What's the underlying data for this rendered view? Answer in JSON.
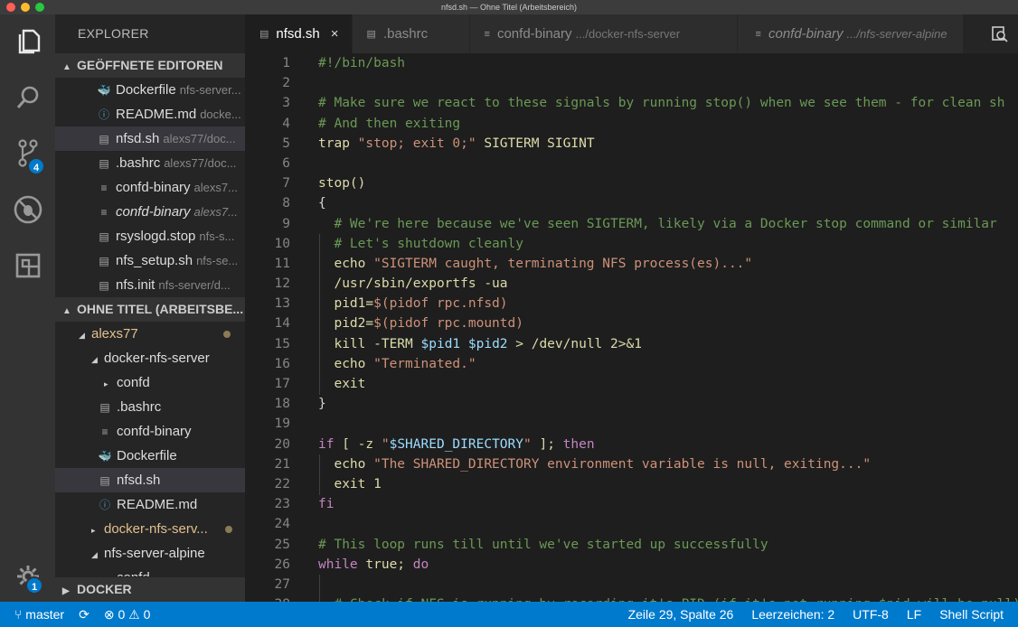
{
  "window": {
    "title": "nfsd.sh — Ohne Titel (Arbeitsbereich)"
  },
  "activity": {
    "scm_badge": "4",
    "settings_badge": "1"
  },
  "sidebar": {
    "title": "EXPLORER",
    "open_editors": {
      "label": "GEÖFFNETE EDITOREN",
      "items": [
        {
          "name": "Dockerfile",
          "path": "nfs-server...",
          "icon": "docker-icon"
        },
        {
          "name": "README.md",
          "path": "docke...",
          "icon": "info-icon"
        },
        {
          "name": "nfsd.sh",
          "path": "alexs77/doc...",
          "icon": "file-icon"
        },
        {
          "name": ".bashrc",
          "path": "alexs77/doc...",
          "icon": "file-icon"
        },
        {
          "name": "confd-binary",
          "path": "alexs7...",
          "icon": "lines-icon"
        },
        {
          "name": "confd-binary",
          "path": "alexs7...",
          "icon": "lines-icon"
        },
        {
          "name": "rsyslogd.stop",
          "path": "nfs-s...",
          "icon": "file-icon"
        },
        {
          "name": "nfs_setup.sh",
          "path": "nfs-se...",
          "icon": "file-icon"
        },
        {
          "name": "nfs.init",
          "path": "nfs-server/d...",
          "icon": "file-icon"
        }
      ]
    },
    "workspace": {
      "label": "OHNE TITEL (ARBEITSBE...",
      "tree": [
        {
          "name": "alexs77"
        },
        {
          "name": "docker-nfs-server"
        },
        {
          "name": "confd"
        },
        {
          "name": ".bashrc"
        },
        {
          "name": "confd-binary"
        },
        {
          "name": "Dockerfile"
        },
        {
          "name": "nfsd.sh"
        },
        {
          "name": "README.md"
        },
        {
          "name": "docker-nfs-serv..."
        },
        {
          "name": "nfs-server-alpine"
        },
        {
          "name": "confd"
        }
      ]
    },
    "docker": {
      "label": "DOCKER"
    }
  },
  "tabs": [
    {
      "name": "nfsd.sh",
      "dir": "",
      "close": "×"
    },
    {
      "name": ".bashrc",
      "dir": ""
    },
    {
      "name": "confd-binary",
      "dir": ".../docker-nfs-server"
    },
    {
      "name": "confd-binary",
      "dir": ".../nfs-server-alpine"
    }
  ],
  "code": {
    "line_numbers": [
      "1",
      "2",
      "3",
      "4",
      "5",
      "6",
      "7",
      "8",
      "9",
      "10",
      "11",
      "12",
      "13",
      "14",
      "15",
      "16",
      "17",
      "18",
      "19",
      "20",
      "21",
      "22",
      "23",
      "24",
      "25",
      "26",
      "27",
      "28"
    ],
    "lines": [
      [
        [
          "#!/bin/bash",
          "com"
        ]
      ],
      [],
      [
        [
          "# Make sure we react to these signals by running stop() when we see them - for clean sh",
          "com"
        ]
      ],
      [
        [
          "# And then exiting",
          "com"
        ]
      ],
      [
        [
          "trap ",
          "fn"
        ],
        [
          "\"stop; exit 0;\"",
          "str"
        ],
        [
          " SIGTERM SIGINT",
          "fn"
        ]
      ],
      [],
      [
        [
          "stop()",
          "fn"
        ]
      ],
      [
        [
          "{",
          "txt"
        ]
      ],
      [
        [
          "  # We're here because we've seen SIGTERM, likely via a Docker stop command or similar",
          "com"
        ]
      ],
      [
        [
          "  # Let's shutdown cleanly",
          "com"
        ]
      ],
      [
        [
          "  echo ",
          "fn"
        ],
        [
          "\"SIGTERM caught, terminating NFS process(es)...\"",
          "str"
        ]
      ],
      [
        [
          "  /usr/sbin/exportfs -ua",
          "fn"
        ]
      ],
      [
        [
          "  pid1=",
          "fn"
        ],
        [
          "$(pidof rpc.nfsd)",
          "str"
        ]
      ],
      [
        [
          "  pid2=",
          "fn"
        ],
        [
          "$(pidof rpc.mountd)",
          "str"
        ]
      ],
      [
        [
          "  kill -TERM ",
          "fn"
        ],
        [
          "$pid1 $pid2",
          "var"
        ],
        [
          " > /dev/null 2>&1",
          "fn"
        ]
      ],
      [
        [
          "  echo ",
          "fn"
        ],
        [
          "\"Terminated.\"",
          "str"
        ]
      ],
      [
        [
          "  exit",
          "fn"
        ]
      ],
      [
        [
          "}",
          "txt"
        ]
      ],
      [],
      [
        [
          "if",
          "kw"
        ],
        [
          " [ -z ",
          "fn"
        ],
        [
          "\"",
          "str"
        ],
        [
          "$SHARED_DIRECTORY",
          "var"
        ],
        [
          "\"",
          "str"
        ],
        [
          " ]; ",
          "fn"
        ],
        [
          "then",
          "kw"
        ]
      ],
      [
        [
          "  echo ",
          "fn"
        ],
        [
          "\"The SHARED_DIRECTORY environment variable is null, exiting...\"",
          "str"
        ]
      ],
      [
        [
          "  exit 1",
          "fn"
        ]
      ],
      [
        [
          "fi",
          "kw"
        ]
      ],
      [],
      [
        [
          "# This loop runs till until we've started up successfully",
          "com"
        ]
      ],
      [
        [
          "while",
          "kw"
        ],
        [
          " true; ",
          "fn"
        ],
        [
          "do",
          "kw"
        ]
      ],
      [],
      [
        [
          "  # Check if NFS is running by recording it's PID (if it's not running $pid will be null)",
          "com"
        ]
      ]
    ]
  },
  "status": {
    "branch": "master",
    "errors": "0",
    "warnings": "0",
    "position": "Zeile 29, Spalte 26",
    "indent": "Leerzeichen: 2",
    "encoding": "UTF-8",
    "eol": "LF",
    "language": "Shell Script"
  }
}
